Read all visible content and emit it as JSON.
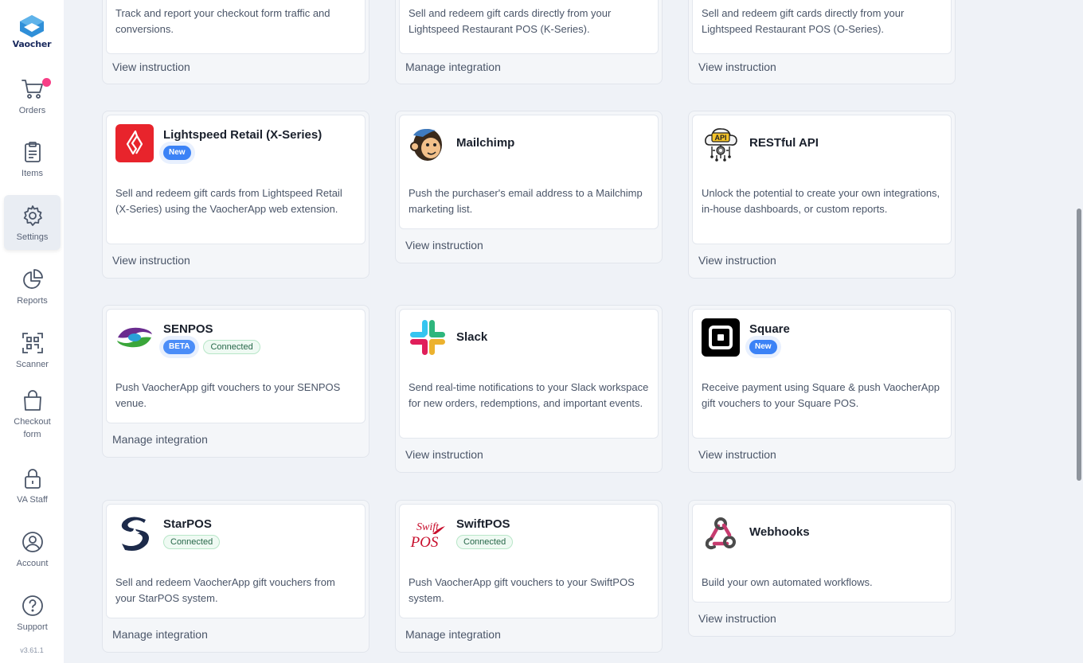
{
  "app": {
    "logo_text": "Vaocher",
    "version": "v3.61.1"
  },
  "sidebar": {
    "items": [
      {
        "label": "Orders"
      },
      {
        "label": "Items"
      },
      {
        "label": "Settings"
      },
      {
        "label": "Reports"
      },
      {
        "label": "Scanner"
      },
      {
        "label": "Checkout form"
      },
      {
        "label": "VA Staff"
      },
      {
        "label": "Account"
      },
      {
        "label": "Support"
      }
    ]
  },
  "integrations": {
    "row0": [
      {
        "description": "Track and report your checkout form traffic and conversions.",
        "action": "View instruction"
      },
      {
        "description": "Sell and redeem gift cards directly from your Lightspeed Restaurant POS (K-Series).",
        "action": "Manage integration"
      },
      {
        "description": "Sell and redeem gift cards directly from your Lightspeed Restaurant POS (O-Series).",
        "action": "View instruction"
      }
    ],
    "lightspeed_retail": {
      "title": "Lightspeed Retail (X-Series)",
      "tag": "New",
      "description": "Sell and redeem gift cards from Lightspeed Retail (X-Series) using the VaocherApp web extension.",
      "action": "View instruction"
    },
    "mailchimp": {
      "title": "Mailchimp",
      "description": "Push the purchaser's email address to a Mailchimp marketing list.",
      "action": "View instruction"
    },
    "restful": {
      "title": "RESTful API",
      "description": "Unlock the potential to create your own integrations, in-house dashboards, or custom reports.",
      "action": "View instruction",
      "logo_text": "API"
    },
    "senpos": {
      "title": "SENPOS",
      "tags": [
        "BETA",
        "Connected"
      ],
      "description": "Push VaocherApp gift vouchers to your SENPOS venue.",
      "action": "Manage integration"
    },
    "slack": {
      "title": "Slack",
      "description": "Send real-time notifications to your Slack workspace for new orders, redemptions, and important events.",
      "action": "View instruction"
    },
    "square": {
      "title": "Square",
      "tag": "New",
      "description": "Receive payment using Square & push VaocherApp gift vouchers to your Square POS.",
      "action": "View instruction"
    },
    "starpos": {
      "title": "StarPOS",
      "tag": "Connected",
      "description": "Sell and redeem VaocherApp gift vouchers from your StarPOS system.",
      "action": "Manage integration"
    },
    "swiftpos": {
      "title": "SwiftPOS",
      "tag": "Connected",
      "description": "Push VaocherApp gift vouchers to your SwiftPOS system.",
      "action": "Manage integration",
      "logo_text_1": "Swift",
      "logo_text_2": "POS"
    },
    "webhooks": {
      "title": "Webhooks",
      "description": "Build your own automated workflows.",
      "action": "View instruction"
    }
  },
  "colors": {
    "accent": "#3b82f6",
    "notification": "#f73e86",
    "lightspeed": "#e8242c",
    "connected_bg": "#effaf3"
  },
  "icons": [
    "cart-icon",
    "clipboard-icon",
    "gear-icon",
    "pie-chart-icon",
    "qr-scan-icon",
    "bag-icon",
    "lock-icon",
    "user-circle-icon",
    "help-circle-icon"
  ]
}
